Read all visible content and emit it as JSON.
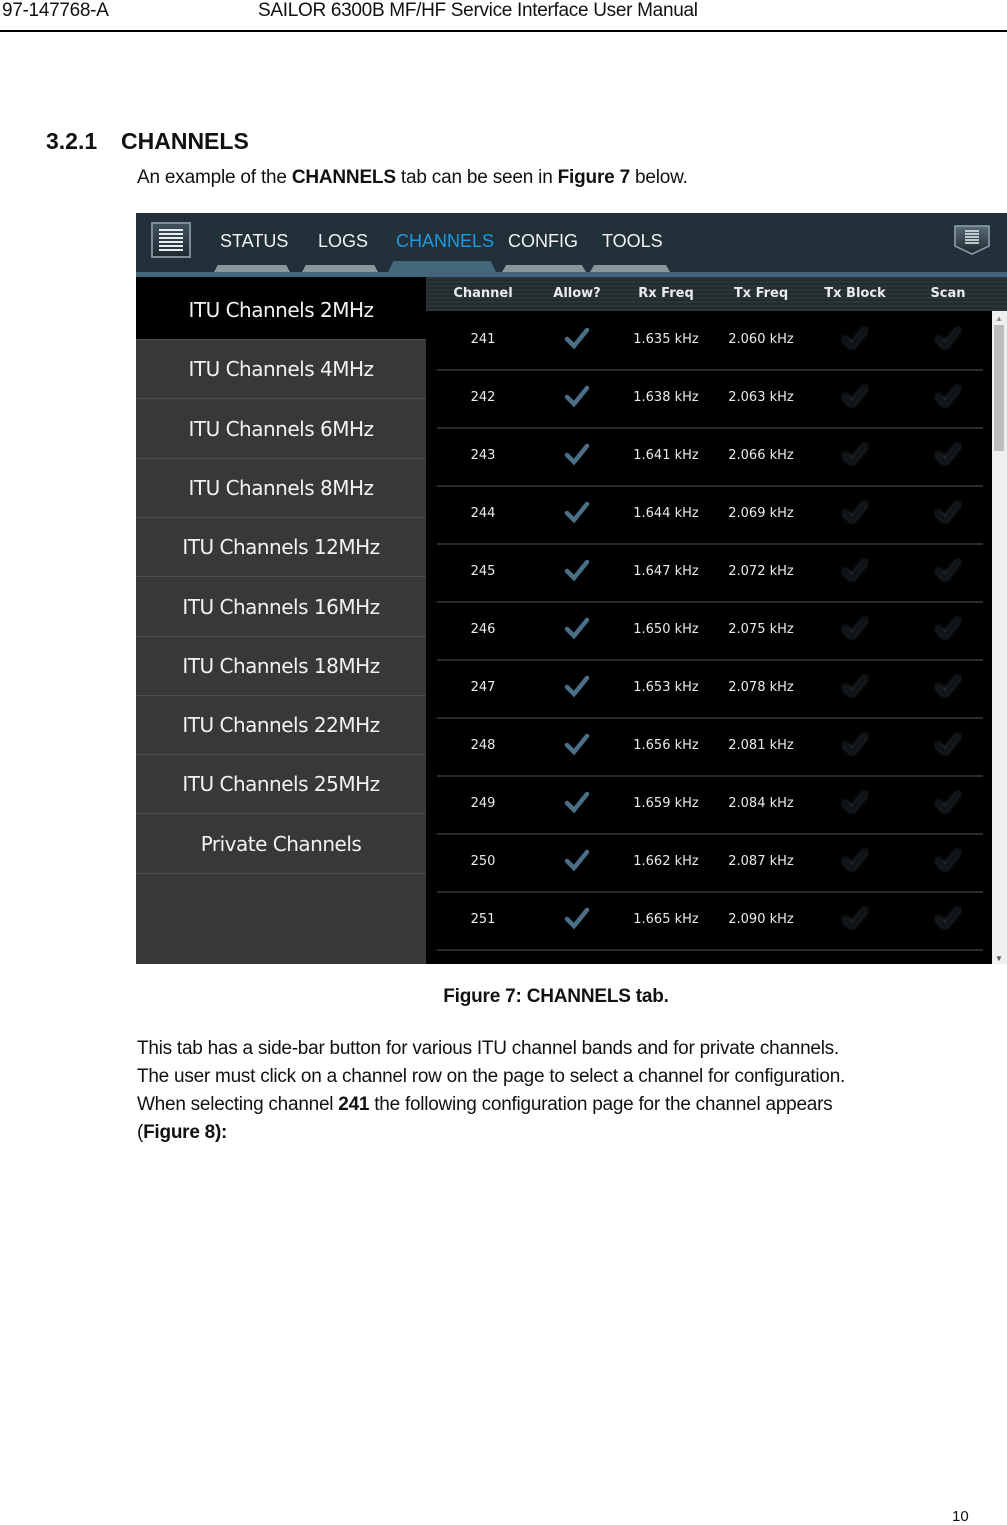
{
  "header": {
    "doc_id": "97-147768-A",
    "doc_title": "SAILOR 6300B MF/HF Service Interface User Manual"
  },
  "section": {
    "number": "3.2.1",
    "title": "CHANNELS",
    "intro_pre": "An example of the ",
    "intro_bold1": "CHANNELS",
    "intro_mid": " tab can be seen in ",
    "intro_bold2": "Figure 7",
    "intro_post": " below."
  },
  "app": {
    "left_icon": "menu-list-icon",
    "right_icon": "menu-dropdown-icon",
    "tabs": [
      {
        "label": "STATUS",
        "active": false
      },
      {
        "label": "LOGS",
        "active": false
      },
      {
        "label": "CHANNELS",
        "active": true
      },
      {
        "label": "CONFIG",
        "active": false
      },
      {
        "label": "TOOLS",
        "active": false
      }
    ],
    "sidebar": [
      {
        "label": "ITU Channels 2MHz",
        "active": true
      },
      {
        "label": "ITU Channels 4MHz",
        "active": false
      },
      {
        "label": "ITU Channels 6MHz",
        "active": false
      },
      {
        "label": "ITU Channels 8MHz",
        "active": false
      },
      {
        "label": "ITU Channels 12MHz",
        "active": false
      },
      {
        "label": "ITU Channels 16MHz",
        "active": false
      },
      {
        "label": "ITU Channels 18MHz",
        "active": false
      },
      {
        "label": "ITU Channels 22MHz",
        "active": false
      },
      {
        "label": "ITU Channels 25MHz",
        "active": false
      },
      {
        "label": "Private Channels",
        "active": false
      }
    ],
    "columns": [
      "Channel",
      "Allow?",
      "Rx Freq",
      "Tx Freq",
      "Tx Block",
      "Scan"
    ],
    "rows": [
      {
        "channel": "241",
        "allow": true,
        "rx": "1.635 kHz",
        "tx": "2.060 kHz",
        "tx_block": false,
        "scan": false
      },
      {
        "channel": "242",
        "allow": true,
        "rx": "1.638 kHz",
        "tx": "2.063 kHz",
        "tx_block": false,
        "scan": false
      },
      {
        "channel": "243",
        "allow": true,
        "rx": "1.641 kHz",
        "tx": "2.066 kHz",
        "tx_block": false,
        "scan": false
      },
      {
        "channel": "244",
        "allow": true,
        "rx": "1.644 kHz",
        "tx": "2.069 kHz",
        "tx_block": false,
        "scan": false
      },
      {
        "channel": "245",
        "allow": true,
        "rx": "1.647 kHz",
        "tx": "2.072 kHz",
        "tx_block": false,
        "scan": false
      },
      {
        "channel": "246",
        "allow": true,
        "rx": "1.650 kHz",
        "tx": "2.075 kHz",
        "tx_block": false,
        "scan": false
      },
      {
        "channel": "247",
        "allow": true,
        "rx": "1.653 kHz",
        "tx": "2.078 kHz",
        "tx_block": false,
        "scan": false
      },
      {
        "channel": "248",
        "allow": true,
        "rx": "1.656 kHz",
        "tx": "2.081 kHz",
        "tx_block": false,
        "scan": false
      },
      {
        "channel": "249",
        "allow": true,
        "rx": "1.659 kHz",
        "tx": "2.084 kHz",
        "tx_block": false,
        "scan": false
      },
      {
        "channel": "250",
        "allow": true,
        "rx": "1.662 kHz",
        "tx": "2.087 kHz",
        "tx_block": false,
        "scan": false
      },
      {
        "channel": "251",
        "allow": true,
        "rx": "1.665 kHz",
        "tx": "2.090 kHz",
        "tx_block": false,
        "scan": false
      }
    ],
    "colors": {
      "active_tab": "#1e9be0",
      "check_on": "#4a6f86",
      "check_off": "#111417"
    }
  },
  "caption": "Figure 7: CHANNELS tab.",
  "body": {
    "line1": "This tab has a side-bar button for various ITU channel bands and for private channels.",
    "line2": "The user must click on a channel row on the page to select a channel for configuration.",
    "line3_pre": "When selecting channel ",
    "line3_bold": "241",
    "line3_post": " the following configuration page for the channel appears",
    "line4_open": "(",
    "line4_bold": "Figure 8):"
  },
  "page_number": "10"
}
